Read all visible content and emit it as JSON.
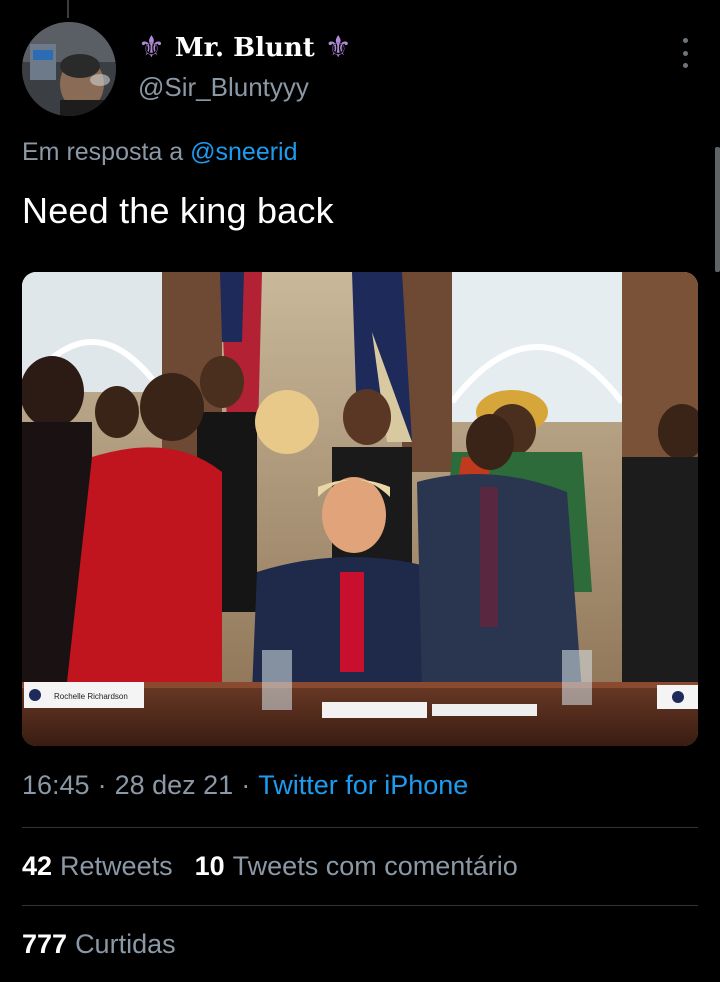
{
  "author": {
    "display_name": "Mr. Blunt",
    "handle": "@Sir_Bluntyyy",
    "name_decoration": "⚜"
  },
  "reply": {
    "prefix": "Em resposta a",
    "mention": "@sneerid"
  },
  "tweet": {
    "text": "Need the king back"
  },
  "media": {
    "placard_left": "Rochelle Richardson"
  },
  "meta": {
    "time": "16:45",
    "separator": "·",
    "date": "28 dez 21",
    "source": "Twitter for iPhone"
  },
  "stats": {
    "retweets_count": "42",
    "retweets_label": "Retweets",
    "quotes_count": "10",
    "quotes_label": "Tweets com comentário",
    "likes_count": "777",
    "likes_label": "Curtidas"
  },
  "colors": {
    "background": "#000000",
    "link": "#1d9bf0",
    "secondary_text": "#8b98a5",
    "primary_text": "#ffffff",
    "fleur": "#b08ad8"
  },
  "icons": {
    "more": "more-vertical-icon",
    "fleur": "fleur-de-lis-icon"
  }
}
